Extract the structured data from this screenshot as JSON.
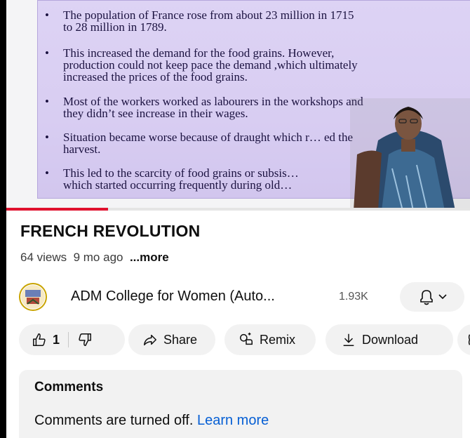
{
  "video": {
    "bullets": [
      {
        "lines": [
          "The population of France rose from about 23 million in 1715",
          "to 28 million in 1789."
        ]
      },
      {
        "lines": [
          "This increased the demand for the food grains. However,",
          "production could not keep pace the demand ,which ultimately",
          "increased the prices of the food grains."
        ]
      },
      {
        "lines": [
          "Most of the workers worked as labourers in the workshops and",
          "they didn’t see increase in their wages."
        ]
      },
      {
        "lines": [
          "Situation became worse because of draught which r… ed the",
          "harvest."
        ]
      },
      {
        "lines": [
          "This led to the scarcity of food grains or subsis…",
          "which started occurring frequently during old…"
        ]
      }
    ],
    "bullet_glyph": "•",
    "progress_fraction": 0.22
  },
  "title": "FRENCH REVOLUTION",
  "meta": {
    "views": "64 views",
    "age": "9 mo ago",
    "more": "...more"
  },
  "channel": {
    "name": "ADM College for Women (Auto...",
    "subscribers": "1.93K",
    "bell_icon": "bell-icon"
  },
  "actions": {
    "like_count": "1",
    "share_label": "Share",
    "remix_label": "Remix",
    "download_label": "Download"
  },
  "comments": {
    "title": "Comments",
    "off_text": "Comments are turned off.",
    "learn_more": "Learn more"
  },
  "colors": {
    "accent_red": "#e0112e",
    "link_blue": "#065fd4",
    "pill_bg": "#f2f2f2"
  }
}
